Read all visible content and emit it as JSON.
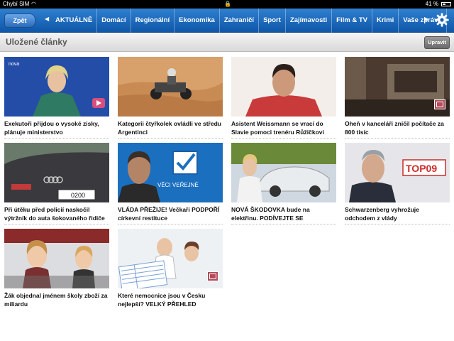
{
  "status_bar": {
    "carrier": "Chybí SIM",
    "battery": "41 %"
  },
  "nav": {
    "back_label": "Zpět",
    "tabs": [
      "AKTUÁLNĚ",
      "Domácí",
      "Regionální",
      "Ekonomika",
      "Zahraničí",
      "Sport",
      "Zajímavosti",
      "Film & TV",
      "Krimi",
      "Vaše zprávy"
    ]
  },
  "header": {
    "title": "Uložené články",
    "edit_label": "Upravit"
  },
  "articles": [
    {
      "title": "Exekutoři přijdou o vysoké zisky, plánuje ministerstvo",
      "badge": "video-icon"
    },
    {
      "title": "Kategorii čtyřkolek ovládli ve středu Argentinci",
      "badge": ""
    },
    {
      "title": "Asistent Weissmann se vrací do Slavie pomoci trenéru Růžičkovi",
      "badge": ""
    },
    {
      "title": "Oheň v kanceláři zničil počítače za 800 tisíc",
      "badge": "gallery-icon"
    },
    {
      "title": "Při útěku před policií naskočil výtržník do auta šokovaného řidiče",
      "badge": ""
    },
    {
      "title": "VLÁDA PŘEŽIJE! Večkaři PODPOŘÍ církevní restituce",
      "badge": ""
    },
    {
      "title": "NOVÁ ŠKODOVKA bude na elektřinu. PODÍVEJTE SE",
      "badge": ""
    },
    {
      "title": "Schwarzenberg vyhrožuje odchodem z vlády",
      "badge": ""
    },
    {
      "title": "Žák objednal jménem školy zboží za miliardu",
      "badge": ""
    },
    {
      "title": "Které nemocnice jsou v Česku nejlepší? VELKÝ PŘEHLED",
      "badge": "gallery-icon"
    }
  ],
  "image_text": {
    "nova_logo": "nova",
    "car_plate": "0200",
    "campaign_banner": "VĚCI VEŘEJNÉ",
    "top09_logo": "TOP09"
  },
  "colors": {
    "nav_blue": "#1a68bd",
    "header_gray": "#d8d8d8",
    "text_dark": "#111111"
  }
}
